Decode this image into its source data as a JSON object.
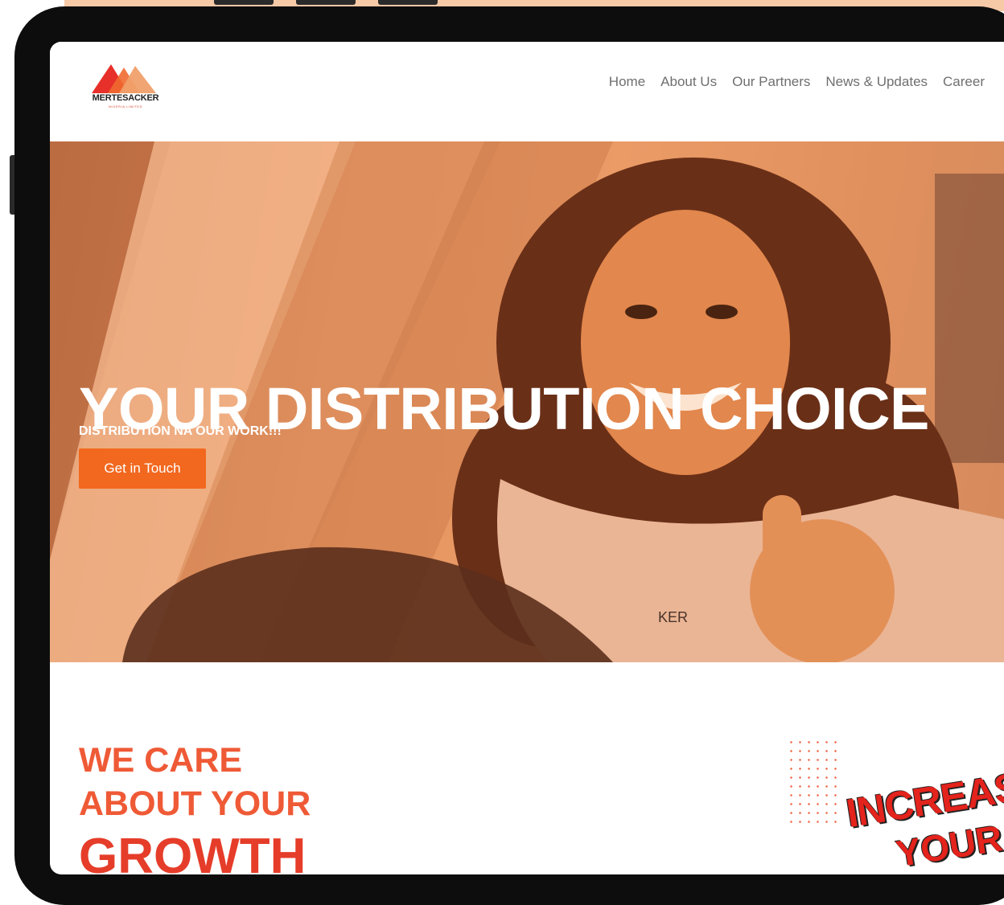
{
  "brand": {
    "name": "MERTESACKER",
    "subtitle": "NIGERIA LIMITED",
    "colors": {
      "accent": "#f2681f",
      "heading_red": "#ef5a36",
      "deep_red": "#e53d2a"
    }
  },
  "nav": {
    "items": [
      {
        "label": "Home"
      },
      {
        "label": "About Us"
      },
      {
        "label": "Our Partners"
      },
      {
        "label": "News & Updates"
      },
      {
        "label": "Career"
      }
    ]
  },
  "hero": {
    "title": "YOUR DISTRIBUTION CHOICE",
    "subtitle": "DISTRIBUTION NA OUR WORK!!!",
    "cta_label": "Get in Touch",
    "shirt_text": "KER"
  },
  "growth": {
    "line1": "WE CARE",
    "line2": "ABOUT YOUR",
    "line3": "GROWTH"
  },
  "promo": {
    "line1": "INCREAS",
    "line2": "YOUR"
  }
}
